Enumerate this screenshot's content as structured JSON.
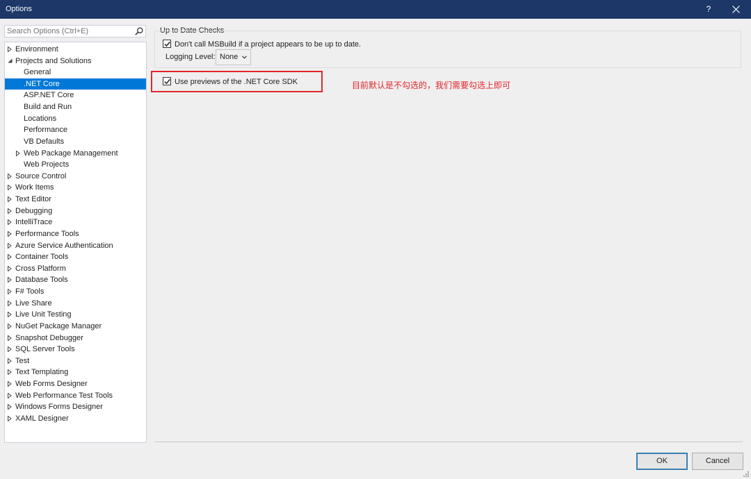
{
  "window": {
    "title": "Options",
    "help_label": "?"
  },
  "search": {
    "placeholder": "Search Options (Ctrl+E)",
    "value": ""
  },
  "tree": {
    "items": [
      {
        "label": "Environment",
        "level": 0,
        "arrow": "collapsed",
        "selected": false
      },
      {
        "label": "Projects and Solutions",
        "level": 0,
        "arrow": "expanded",
        "selected": false
      },
      {
        "label": "General",
        "level": 1,
        "arrow": "none",
        "selected": false
      },
      {
        "label": ".NET Core",
        "level": 1,
        "arrow": "none",
        "selected": true
      },
      {
        "label": "ASP.NET Core",
        "level": 1,
        "arrow": "none",
        "selected": false
      },
      {
        "label": "Build and Run",
        "level": 1,
        "arrow": "none",
        "selected": false
      },
      {
        "label": "Locations",
        "level": 1,
        "arrow": "none",
        "selected": false
      },
      {
        "label": "Performance",
        "level": 1,
        "arrow": "none",
        "selected": false
      },
      {
        "label": "VB Defaults",
        "level": 1,
        "arrow": "none",
        "selected": false
      },
      {
        "label": "Web Package Management",
        "level": 1,
        "arrow": "collapsed",
        "selected": false
      },
      {
        "label": "Web Projects",
        "level": 1,
        "arrow": "none",
        "selected": false
      },
      {
        "label": "Source Control",
        "level": 0,
        "arrow": "collapsed",
        "selected": false
      },
      {
        "label": "Work Items",
        "level": 0,
        "arrow": "collapsed",
        "selected": false
      },
      {
        "label": "Text Editor",
        "level": 0,
        "arrow": "collapsed",
        "selected": false
      },
      {
        "label": "Debugging",
        "level": 0,
        "arrow": "collapsed",
        "selected": false
      },
      {
        "label": "IntelliTrace",
        "level": 0,
        "arrow": "collapsed",
        "selected": false
      },
      {
        "label": "Performance Tools",
        "level": 0,
        "arrow": "collapsed",
        "selected": false
      },
      {
        "label": "Azure Service Authentication",
        "level": 0,
        "arrow": "collapsed",
        "selected": false
      },
      {
        "label": "Container Tools",
        "level": 0,
        "arrow": "collapsed",
        "selected": false
      },
      {
        "label": "Cross Platform",
        "level": 0,
        "arrow": "collapsed",
        "selected": false
      },
      {
        "label": "Database Tools",
        "level": 0,
        "arrow": "collapsed",
        "selected": false
      },
      {
        "label": "F# Tools",
        "level": 0,
        "arrow": "collapsed",
        "selected": false
      },
      {
        "label": "Live Share",
        "level": 0,
        "arrow": "collapsed",
        "selected": false
      },
      {
        "label": "Live Unit Testing",
        "level": 0,
        "arrow": "collapsed",
        "selected": false
      },
      {
        "label": "NuGet Package Manager",
        "level": 0,
        "arrow": "collapsed",
        "selected": false
      },
      {
        "label": "Snapshot Debugger",
        "level": 0,
        "arrow": "collapsed",
        "selected": false
      },
      {
        "label": "SQL Server Tools",
        "level": 0,
        "arrow": "collapsed",
        "selected": false
      },
      {
        "label": "Test",
        "level": 0,
        "arrow": "collapsed",
        "selected": false
      },
      {
        "label": "Text Templating",
        "level": 0,
        "arrow": "collapsed",
        "selected": false
      },
      {
        "label": "Web Forms Designer",
        "level": 0,
        "arrow": "collapsed",
        "selected": false
      },
      {
        "label": "Web Performance Test Tools",
        "level": 0,
        "arrow": "collapsed",
        "selected": false
      },
      {
        "label": "Windows Forms Designer",
        "level": 0,
        "arrow": "collapsed",
        "selected": false
      },
      {
        "label": "XAML Designer",
        "level": 0,
        "arrow": "collapsed",
        "selected": false
      }
    ]
  },
  "content": {
    "group_title": "Up to Date Checks",
    "msbuild_check": {
      "label": "Don't call MSBuild if a project appears to be up to date.",
      "checked": true
    },
    "logging": {
      "label": "Logging Level:",
      "selected": "None"
    },
    "previews_check": {
      "label": "Use previews of the .NET Core SDK",
      "checked": true
    },
    "annotation": "目前默认是不勾选的，我们需要勾选上即可"
  },
  "buttons": {
    "ok": "OK",
    "cancel": "Cancel"
  },
  "colors": {
    "titlebar": "#1d3768",
    "selection": "#0078d7",
    "highlight": "#e2262b"
  }
}
